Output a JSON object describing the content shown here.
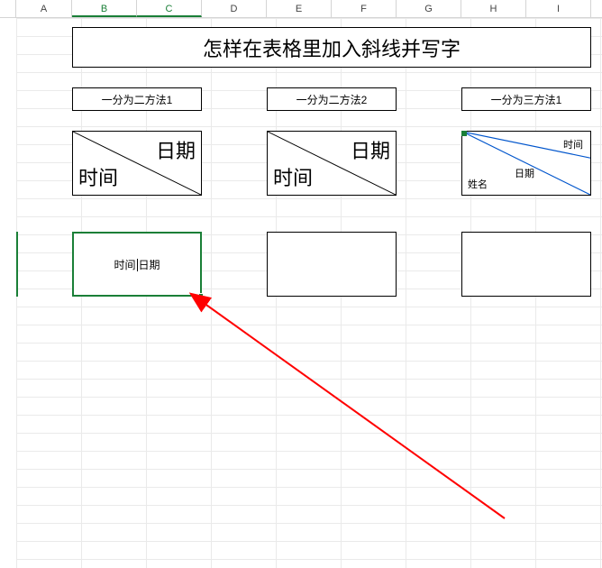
{
  "columns": [
    "A",
    "B",
    "C",
    "D",
    "E",
    "F",
    "G",
    "H",
    "I"
  ],
  "selected_columns": [
    "B",
    "C"
  ],
  "title": "怎样在表格里加入斜线并写字",
  "methods": {
    "m1": "一分为二方法1",
    "m2": "一分为二方法2",
    "m3": "一分为三方法1"
  },
  "diag1": {
    "top": "日期",
    "bottom": "时间"
  },
  "diag2": {
    "top": "日期",
    "bottom": "时间"
  },
  "tri": {
    "a": "时间",
    "b": "日期",
    "c": "姓名"
  },
  "editing": {
    "part1": "时间",
    "part2": "日期"
  },
  "colors": {
    "select": "#1a7f37",
    "arrow": "#ff0000",
    "triline": "#0055cc"
  }
}
